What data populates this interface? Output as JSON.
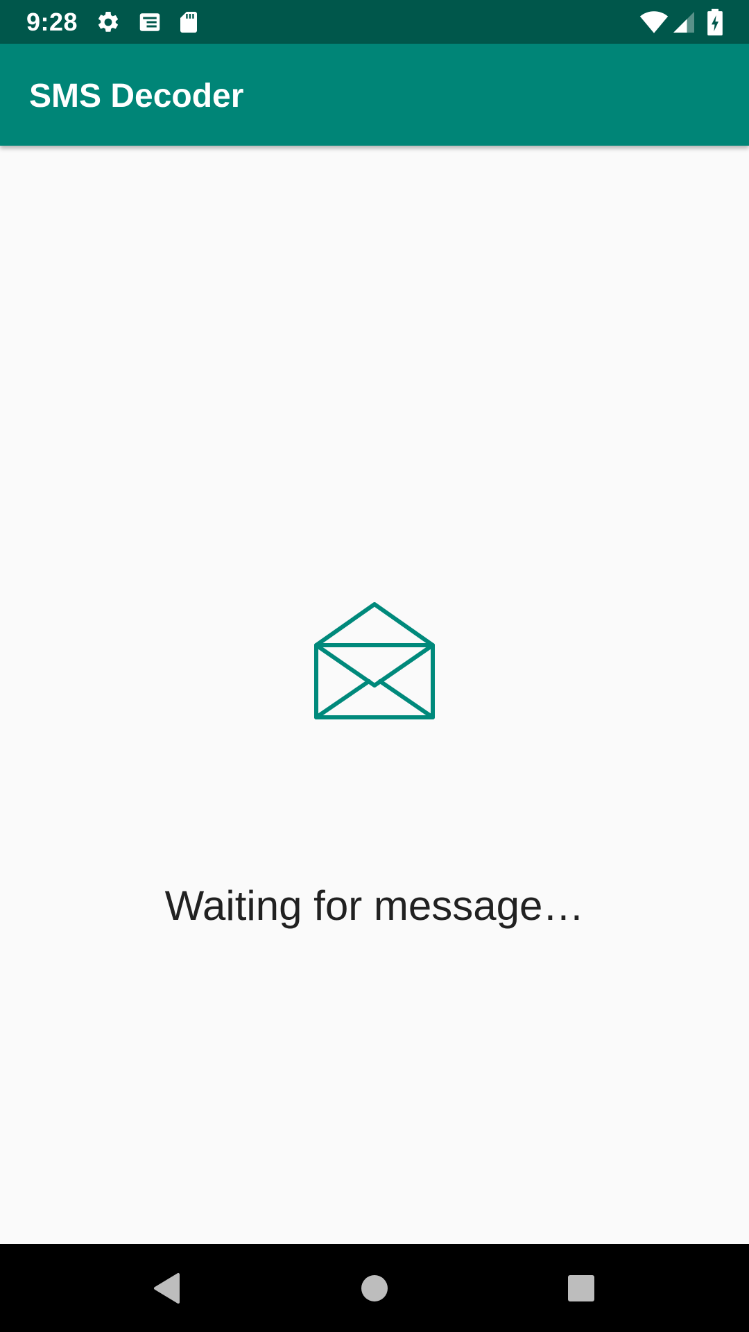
{
  "status_bar": {
    "time": "9:28",
    "icons": [
      "settings-icon",
      "notification-icon",
      "sd-card-icon",
      "wifi-icon",
      "signal-icon",
      "battery-charging-icon"
    ]
  },
  "app_bar": {
    "title": "SMS Decoder"
  },
  "main": {
    "icon": "envelope-open-icon",
    "status_text": "Waiting for message…"
  },
  "nav_bar": {
    "buttons": [
      "back-icon",
      "home-icon",
      "recents-icon"
    ]
  },
  "colors": {
    "primary": "#008577",
    "primary_dark": "#00574b",
    "accent_icon": "#00897b",
    "background": "#fafafa",
    "text": "#212121"
  }
}
